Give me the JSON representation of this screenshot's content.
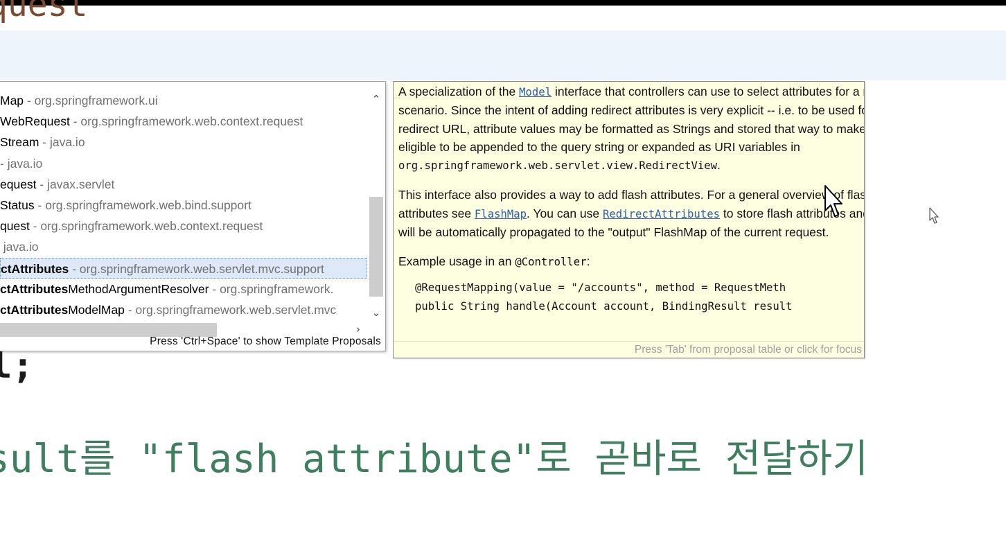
{
  "editor": {
    "top_code": "quest",
    "semicolon_line": "l;",
    "comment_line": "sult를 \"flash attribute\"로 곧바로 전달하기"
  },
  "proposals": {
    "items": [
      {
        "name_bold": "",
        "name": "Map",
        "sep": " - ",
        "package": "org.springframework.ui"
      },
      {
        "name_bold": "",
        "name": "WebRequest",
        "sep": " - ",
        "package": "org.springframework.web.context.request"
      },
      {
        "name_bold": "",
        "name": "Stream",
        "sep": " - ",
        "package": "java.io"
      },
      {
        "name_bold": "",
        "name": "",
        "sep": "- ",
        "package": "java.io"
      },
      {
        "name_bold": "",
        "name": "equest",
        "sep": " - ",
        "package": "javax.servlet"
      },
      {
        "name_bold": "",
        "name": "Status",
        "sep": " - ",
        "package": "org.springframework.web.bind.support"
      },
      {
        "name_bold": "",
        "name": "quest",
        "sep": " - ",
        "package": "org.springframework.web.context.request"
      },
      {
        "name_bold": "",
        "name": "",
        "sep": " ",
        "package": "java.io"
      },
      {
        "name_bold": "ctAttributes",
        "name": "",
        "sep": " - ",
        "package": "org.springframework.web.servlet.mvc.support",
        "selected": true
      },
      {
        "name_bold": "ctAttributes",
        "name": "MethodArgumentResolver",
        "sep": " - ",
        "package": "org.springframework."
      },
      {
        "name_bold": "ctAttributes",
        "name": "ModelMap",
        "sep": " - ",
        "package": "org.springframework.web.servlet.mvc"
      }
    ],
    "footer": "Press 'Ctrl+Space' to show Template Proposals"
  },
  "doc": {
    "p1_a": "A specialization of the ",
    "p1_link_model": "Model",
    "p1_b": " interface that controllers can use to select attributes for a redirect scenario. Since the intent of adding redirect attributes is very explicit -- i.e. to be used for a redirect URL, attribute values may be formatted as Strings and stored that way to make them eligible to be appended to the query string or expanded as URI variables in ",
    "p1_code": "org.springframework.web.servlet.view.RedirectView",
    "p1_end": ".",
    "p2_a": "This interface also provides a way to add flash attributes. For a general overview of flash attributes see ",
    "p2_link_flashmap": "FlashMap",
    "p2_b": ". You can use ",
    "p2_link_redirect": "RedirectAttributes",
    "p2_c": " to store flash attributes and they will be automatically propagated to the \"output\" FlashMap of the current request.",
    "p3_a": "Example usage in an ",
    "p3_code": "@Controller",
    "p3_end": ":",
    "code_line1": "@RequestMapping(value = \"/accounts\", method = RequestMeth",
    "code_line2": "public String handle(Account account, BindingResult result",
    "footer": "Press 'Tab' from proposal table or click for focus"
  }
}
